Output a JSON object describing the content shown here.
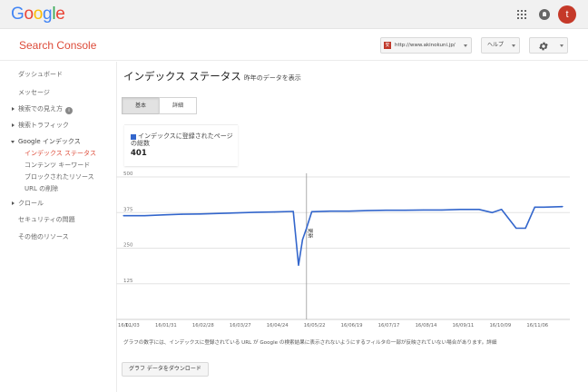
{
  "google_logo": [
    {
      "ch": "G",
      "color": "#4285f4"
    },
    {
      "ch": "o",
      "color": "#ea4335"
    },
    {
      "ch": "o",
      "color": "#fbbc05"
    },
    {
      "ch": "g",
      "color": "#4285f4"
    },
    {
      "ch": "l",
      "color": "#34a853"
    },
    {
      "ch": "e",
      "color": "#ea4335"
    }
  ],
  "topbar": {
    "avatar_letter": "t"
  },
  "header": {
    "product_title": "Search Console",
    "site_favicon_char": "安",
    "site_url": "http://www.akinokuni.jp/",
    "help_label": "ヘルプ"
  },
  "sidebar": {
    "items": [
      {
        "label": "ダッシュボード"
      },
      {
        "label": "メッセージ"
      },
      {
        "label": "検索での見え方"
      },
      {
        "label": "検索トラフィック"
      },
      {
        "label": "Google インデックス"
      },
      {
        "label": "クロール"
      },
      {
        "label": "セキュリティの問題"
      },
      {
        "label": "その他のリソース"
      }
    ],
    "sub_items": [
      {
        "label": "インデックス ステータス"
      },
      {
        "label": "コンテンツ キーワード"
      },
      {
        "label": "ブロックされたリソース"
      },
      {
        "label": "URL の削除"
      }
    ]
  },
  "main": {
    "title": "インデックス ステータス",
    "title_note": "昨年のデータを表示",
    "tabs": [
      {
        "label": "基本"
      },
      {
        "label": "詳細"
      }
    ],
    "legend_label": "インデックスに登録されたページの総数",
    "legend_value": "401",
    "footnote": "グラフの数字には、インデックスに登録されている URL が Google の検索結果に表示されないようにするフィルタの一部が反映されていない場合があります。詳細",
    "download_label": "グラフ データをダウンロード"
  },
  "colors": {
    "series": "#3366cc",
    "accent": "#dd4b39"
  },
  "chart_data": {
    "type": "line",
    "series": [
      {
        "name": "インデックスに登録されたページの総数",
        "x": [
          "16/01/01",
          "16/01/03",
          "16/01/17",
          "16/01/31",
          "16/02/14",
          "16/02/28",
          "16/03/13",
          "16/03/27",
          "16/04/10",
          "16/04/24",
          "16/05/08",
          "16/05/12",
          "16/05/15",
          "16/05/18",
          "16/05/22",
          "16/06/05",
          "16/06/19",
          "16/07/03",
          "16/07/17",
          "16/07/31",
          "16/08/14",
          "16/08/28",
          "16/09/11",
          "16/09/25",
          "16/10/05",
          "16/10/12",
          "16/10/23",
          "16/10/30",
          "16/11/06",
          "16/11/13",
          "16/11/27"
        ],
        "values": [
          364,
          364,
          364,
          367,
          369,
          370,
          372,
          374,
          376,
          377,
          379,
          190,
          280,
          320,
          378,
          380,
          380,
          382,
          383,
          383,
          384,
          384,
          386,
          386,
          375,
          386,
          320,
          320,
          394,
          394,
          396
        ]
      }
    ],
    "x_tick_labels": [
      "1...",
      "16/01/03",
      "16/01/31",
      "16/02/28",
      "16/03/27",
      "16/04/24",
      "16/05/22",
      "16/06/19",
      "16/07/17",
      "16/08/14",
      "16/09/11",
      "16/10/09",
      "16/11/06"
    ],
    "y_ticks": [
      125,
      250,
      375,
      500
    ],
    "ylim": [
      0,
      500
    ],
    "annotation": {
      "x": "16/05/18",
      "label": "更新"
    },
    "grid": true,
    "legend": "top-left"
  }
}
